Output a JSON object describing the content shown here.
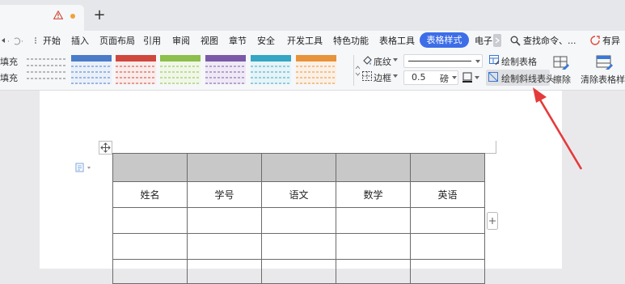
{
  "title_bar": {
    "new_tab_glyph": "+",
    "warning_icon": "warning-triangle-icon",
    "dot_color": "#f0a23b"
  },
  "menu": {
    "items": [
      "开始",
      "插入",
      "页面布局",
      "引用",
      "审阅",
      "视图",
      "章节",
      "安全",
      "开发工具",
      "特色功能",
      "表格工具"
    ],
    "active": "表格样式",
    "partial": "电子",
    "search": "查找命令、...",
    "right": "有异",
    "active_color": "#3d6ee8"
  },
  "ribbon": {
    "fill_label_1": "填充",
    "fill_label_2": "填充",
    "shading": "底纹",
    "border": "边框",
    "line_width": "0.5",
    "unit": "磅",
    "draw_table": "绘制表格",
    "draw_diagonal": "绘制斜线表头",
    "erase": "擦除",
    "clear_style": "清除表格样式",
    "swatch_colors": [
      "#9e9e9e",
      "#4a7cc9",
      "#d0473d",
      "#8cbf4b",
      "#7a5aa8",
      "#35a6c4",
      "#e8923a"
    ]
  },
  "table": {
    "headers": [
      "姓名",
      "学号",
      "语文",
      "数学",
      "英语"
    ]
  },
  "annotation": {
    "arrow_color": "#e53a3a"
  }
}
